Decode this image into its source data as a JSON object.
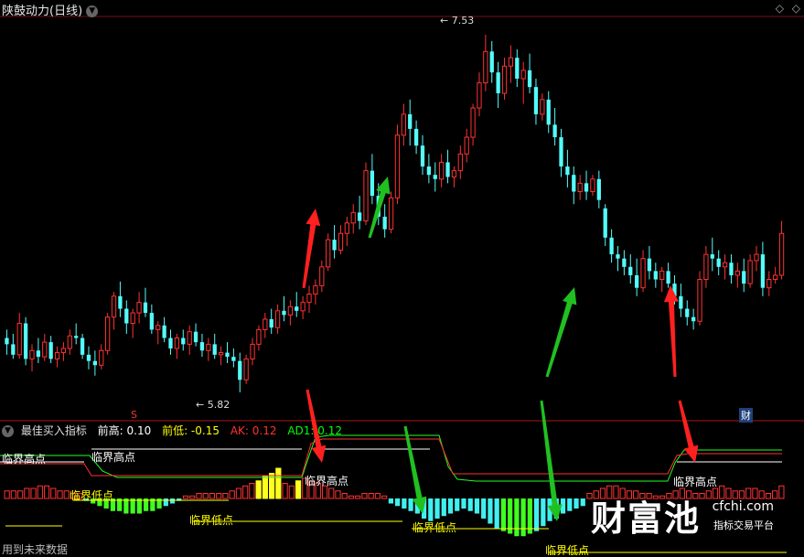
{
  "header": {
    "title": "陕鼓动力(日线)",
    "dropdown_icon": "chevron-down-icon",
    "corner_icons": [
      "diamond-icon",
      "diamond-icon"
    ]
  },
  "chart_data": [
    {
      "type": "candlestick",
      "title": "陕鼓动力(日线)",
      "annotations": {
        "high_label": "7.53",
        "low_label": "5.82",
        "s_marker": "S",
        "tag": "财"
      },
      "colors": {
        "up": "#ff3232",
        "down": "#54fcfc",
        "bg": "#000000"
      },
      "ylim": [
        5.75,
        7.6
      ],
      "candles": [
        {
          "o": 6.08,
          "h": 6.12,
          "l": 6.0,
          "c": 6.05
        },
        {
          "o": 6.05,
          "h": 6.1,
          "l": 5.98,
          "c": 6.0
        },
        {
          "o": 6.0,
          "h": 6.2,
          "l": 5.98,
          "c": 6.15
        },
        {
          "o": 6.15,
          "h": 6.18,
          "l": 5.95,
          "c": 5.98
        },
        {
          "o": 5.98,
          "h": 6.05,
          "l": 5.92,
          "c": 6.02
        },
        {
          "o": 6.02,
          "h": 6.08,
          "l": 5.96,
          "c": 5.99
        },
        {
          "o": 5.99,
          "h": 6.1,
          "l": 5.97,
          "c": 6.06
        },
        {
          "o": 6.06,
          "h": 6.09,
          "l": 5.96,
          "c": 5.98
        },
        {
          "o": 5.98,
          "h": 6.04,
          "l": 5.94,
          "c": 6.01
        },
        {
          "o": 6.01,
          "h": 6.06,
          "l": 5.97,
          "c": 6.03
        },
        {
          "o": 6.03,
          "h": 6.12,
          "l": 6.0,
          "c": 6.09
        },
        {
          "o": 6.09,
          "h": 6.15,
          "l": 6.05,
          "c": 6.08
        },
        {
          "o": 6.08,
          "h": 6.1,
          "l": 5.98,
          "c": 6.0
        },
        {
          "o": 6.0,
          "h": 6.04,
          "l": 5.93,
          "c": 5.97
        },
        {
          "o": 5.97,
          "h": 6.02,
          "l": 5.9,
          "c": 5.95
        },
        {
          "o": 5.95,
          "h": 6.05,
          "l": 5.93,
          "c": 6.02
        },
        {
          "o": 6.02,
          "h": 6.2,
          "l": 6.0,
          "c": 6.18
        },
        {
          "o": 6.18,
          "h": 6.3,
          "l": 6.12,
          "c": 6.28
        },
        {
          "o": 6.28,
          "h": 6.35,
          "l": 6.18,
          "c": 6.22
        },
        {
          "o": 6.22,
          "h": 6.26,
          "l": 6.1,
          "c": 6.15
        },
        {
          "o": 6.15,
          "h": 6.22,
          "l": 6.08,
          "c": 6.2
        },
        {
          "o": 6.2,
          "h": 6.3,
          "l": 6.15,
          "c": 6.25
        },
        {
          "o": 6.25,
          "h": 6.32,
          "l": 6.18,
          "c": 6.2
        },
        {
          "o": 6.2,
          "h": 6.24,
          "l": 6.1,
          "c": 6.12
        },
        {
          "o": 6.12,
          "h": 6.16,
          "l": 6.05,
          "c": 6.14
        },
        {
          "o": 6.14,
          "h": 6.18,
          "l": 6.06,
          "c": 6.08
        },
        {
          "o": 6.08,
          "h": 6.12,
          "l": 6.0,
          "c": 6.03
        },
        {
          "o": 6.03,
          "h": 6.1,
          "l": 5.98,
          "c": 6.08
        },
        {
          "o": 6.08,
          "h": 6.12,
          "l": 6.02,
          "c": 6.05
        },
        {
          "o": 6.05,
          "h": 6.14,
          "l": 6.0,
          "c": 6.11
        },
        {
          "o": 6.11,
          "h": 6.15,
          "l": 6.04,
          "c": 6.06
        },
        {
          "o": 6.06,
          "h": 6.1,
          "l": 5.99,
          "c": 6.02
        },
        {
          "o": 6.02,
          "h": 6.08,
          "l": 5.97,
          "c": 6.05
        },
        {
          "o": 6.05,
          "h": 6.1,
          "l": 5.98,
          "c": 6.0
        },
        {
          "o": 6.0,
          "h": 6.04,
          "l": 5.95,
          "c": 6.01
        },
        {
          "o": 6.01,
          "h": 6.06,
          "l": 5.96,
          "c": 5.99
        },
        {
          "o": 5.99,
          "h": 6.03,
          "l": 5.94,
          "c": 5.97
        },
        {
          "o": 5.97,
          "h": 6.01,
          "l": 5.82,
          "c": 5.88
        },
        {
          "o": 5.88,
          "h": 6.0,
          "l": 5.86,
          "c": 5.98
        },
        {
          "o": 5.98,
          "h": 6.08,
          "l": 5.95,
          "c": 6.05
        },
        {
          "o": 6.05,
          "h": 6.14,
          "l": 6.02,
          "c": 6.12
        },
        {
          "o": 6.12,
          "h": 6.2,
          "l": 6.08,
          "c": 6.17
        },
        {
          "o": 6.17,
          "h": 6.22,
          "l": 6.1,
          "c": 6.13
        },
        {
          "o": 6.13,
          "h": 6.24,
          "l": 6.1,
          "c": 6.21
        },
        {
          "o": 6.21,
          "h": 6.28,
          "l": 6.16,
          "c": 6.19
        },
        {
          "o": 6.19,
          "h": 6.26,
          "l": 6.14,
          "c": 6.23
        },
        {
          "o": 6.23,
          "h": 6.3,
          "l": 6.18,
          "c": 6.21
        },
        {
          "o": 6.21,
          "h": 6.28,
          "l": 6.17,
          "c": 6.25
        },
        {
          "o": 6.25,
          "h": 6.33,
          "l": 6.2,
          "c": 6.29
        },
        {
          "o": 6.29,
          "h": 6.36,
          "l": 6.24,
          "c": 6.33
        },
        {
          "o": 6.33,
          "h": 6.45,
          "l": 6.3,
          "c": 6.42
        },
        {
          "o": 6.42,
          "h": 6.58,
          "l": 6.4,
          "c": 6.55
        },
        {
          "o": 6.55,
          "h": 6.62,
          "l": 6.46,
          "c": 6.5
        },
        {
          "o": 6.5,
          "h": 6.62,
          "l": 6.48,
          "c": 6.58
        },
        {
          "o": 6.58,
          "h": 6.66,
          "l": 6.52,
          "c": 6.63
        },
        {
          "o": 6.63,
          "h": 6.72,
          "l": 6.58,
          "c": 6.68
        },
        {
          "o": 6.68,
          "h": 6.76,
          "l": 6.6,
          "c": 6.64
        },
        {
          "o": 6.64,
          "h": 6.92,
          "l": 6.62,
          "c": 6.88
        },
        {
          "o": 6.88,
          "h": 6.96,
          "l": 6.72,
          "c": 6.76
        },
        {
          "o": 6.76,
          "h": 6.82,
          "l": 6.62,
          "c": 6.66
        },
        {
          "o": 6.66,
          "h": 6.72,
          "l": 6.56,
          "c": 6.6
        },
        {
          "o": 6.6,
          "h": 6.78,
          "l": 6.58,
          "c": 6.75
        },
        {
          "o": 6.75,
          "h": 7.1,
          "l": 6.72,
          "c": 7.05
        },
        {
          "o": 7.05,
          "h": 7.2,
          "l": 7.0,
          "c": 7.15
        },
        {
          "o": 7.15,
          "h": 7.22,
          "l": 7.0,
          "c": 7.08
        },
        {
          "o": 7.08,
          "h": 7.12,
          "l": 6.96,
          "c": 7.0
        },
        {
          "o": 7.0,
          "h": 7.05,
          "l": 6.86,
          "c": 6.9
        },
        {
          "o": 6.9,
          "h": 6.96,
          "l": 6.82,
          "c": 6.86
        },
        {
          "o": 6.86,
          "h": 6.92,
          "l": 6.78,
          "c": 6.84
        },
        {
          "o": 6.84,
          "h": 6.96,
          "l": 6.8,
          "c": 6.92
        },
        {
          "o": 6.92,
          "h": 6.98,
          "l": 6.82,
          "c": 6.85
        },
        {
          "o": 6.85,
          "h": 6.9,
          "l": 6.8,
          "c": 6.88
        },
        {
          "o": 6.88,
          "h": 7.0,
          "l": 6.84,
          "c": 6.96
        },
        {
          "o": 6.96,
          "h": 7.08,
          "l": 6.92,
          "c": 7.04
        },
        {
          "o": 7.04,
          "h": 7.2,
          "l": 7.0,
          "c": 7.18
        },
        {
          "o": 7.18,
          "h": 7.35,
          "l": 7.14,
          "c": 7.3
        },
        {
          "o": 7.3,
          "h": 7.53,
          "l": 7.26,
          "c": 7.45
        },
        {
          "o": 7.45,
          "h": 7.5,
          "l": 7.3,
          "c": 7.35
        },
        {
          "o": 7.35,
          "h": 7.4,
          "l": 7.18,
          "c": 7.25
        },
        {
          "o": 7.25,
          "h": 7.42,
          "l": 7.22,
          "c": 7.38
        },
        {
          "o": 7.38,
          "h": 7.48,
          "l": 7.3,
          "c": 7.42
        },
        {
          "o": 7.42,
          "h": 7.46,
          "l": 7.28,
          "c": 7.32
        },
        {
          "o": 7.32,
          "h": 7.4,
          "l": 7.2,
          "c": 7.36
        },
        {
          "o": 7.36,
          "h": 7.44,
          "l": 7.25,
          "c": 7.28
        },
        {
          "o": 7.28,
          "h": 7.32,
          "l": 7.1,
          "c": 7.15
        },
        {
          "o": 7.15,
          "h": 7.25,
          "l": 7.12,
          "c": 7.22
        },
        {
          "o": 7.22,
          "h": 7.26,
          "l": 7.06,
          "c": 7.1
        },
        {
          "o": 7.1,
          "h": 7.18,
          "l": 7.0,
          "c": 7.04
        },
        {
          "o": 7.04,
          "h": 7.08,
          "l": 6.85,
          "c": 6.9
        },
        {
          "o": 6.9,
          "h": 6.98,
          "l": 6.8,
          "c": 6.86
        },
        {
          "o": 6.86,
          "h": 6.9,
          "l": 6.72,
          "c": 6.78
        },
        {
          "o": 6.78,
          "h": 6.86,
          "l": 6.74,
          "c": 6.82
        },
        {
          "o": 6.82,
          "h": 6.88,
          "l": 6.74,
          "c": 6.78
        },
        {
          "o": 6.78,
          "h": 6.86,
          "l": 6.76,
          "c": 6.84
        },
        {
          "o": 6.84,
          "h": 6.88,
          "l": 6.7,
          "c": 6.74
        },
        {
          "o": 6.7,
          "h": 6.72,
          "l": 6.52,
          "c": 6.56
        },
        {
          "o": 6.56,
          "h": 6.6,
          "l": 6.44,
          "c": 6.48
        },
        {
          "o": 6.48,
          "h": 6.52,
          "l": 6.4,
          "c": 6.46
        },
        {
          "o": 6.46,
          "h": 6.5,
          "l": 6.38,
          "c": 6.42
        },
        {
          "o": 6.42,
          "h": 6.48,
          "l": 6.34,
          "c": 6.38
        },
        {
          "o": 6.38,
          "h": 6.46,
          "l": 6.28,
          "c": 6.32
        },
        {
          "o": 6.32,
          "h": 6.5,
          "l": 6.3,
          "c": 6.46
        },
        {
          "o": 6.46,
          "h": 6.52,
          "l": 6.36,
          "c": 6.4
        },
        {
          "o": 6.4,
          "h": 6.44,
          "l": 6.32,
          "c": 6.36
        },
        {
          "o": 6.36,
          "h": 6.42,
          "l": 6.3,
          "c": 6.4
        },
        {
          "o": 6.4,
          "h": 6.44,
          "l": 6.32,
          "c": 6.34
        },
        {
          "o": 6.34,
          "h": 6.38,
          "l": 6.24,
          "c": 6.28
        },
        {
          "o": 6.28,
          "h": 6.34,
          "l": 6.18,
          "c": 6.22
        },
        {
          "o": 6.22,
          "h": 6.26,
          "l": 6.14,
          "c": 6.18
        },
        {
          "o": 6.18,
          "h": 6.22,
          "l": 6.12,
          "c": 6.16
        },
        {
          "o": 6.16,
          "h": 6.4,
          "l": 6.14,
          "c": 6.36
        },
        {
          "o": 6.36,
          "h": 6.52,
          "l": 6.32,
          "c": 6.48
        },
        {
          "o": 6.48,
          "h": 6.56,
          "l": 6.4,
          "c": 6.46
        },
        {
          "o": 6.46,
          "h": 6.5,
          "l": 6.38,
          "c": 6.42
        },
        {
          "o": 6.42,
          "h": 6.48,
          "l": 6.36,
          "c": 6.44
        },
        {
          "o": 6.44,
          "h": 6.48,
          "l": 6.34,
          "c": 6.38
        },
        {
          "o": 6.38,
          "h": 6.44,
          "l": 6.32,
          "c": 6.4
        },
        {
          "o": 6.4,
          "h": 6.46,
          "l": 6.3,
          "c": 6.34
        },
        {
          "o": 6.34,
          "h": 6.48,
          "l": 6.32,
          "c": 6.45
        },
        {
          "o": 6.45,
          "h": 6.52,
          "l": 6.4,
          "c": 6.48
        },
        {
          "o": 6.48,
          "h": 6.54,
          "l": 6.28,
          "c": 6.32
        },
        {
          "o": 6.32,
          "h": 6.4,
          "l": 6.28,
          "c": 6.36
        },
        {
          "o": 6.36,
          "h": 6.42,
          "l": 6.34,
          "c": 6.38
        },
        {
          "o": 6.38,
          "h": 6.64,
          "l": 6.36,
          "c": 6.58
        }
      ]
    },
    {
      "type": "bar",
      "title": "最佳买入指标",
      "legend": [
        {
          "label": "前高: 0.10",
          "color": "#ffffff"
        },
        {
          "label": "前低: -0.15",
          "color": "#ffff00"
        },
        {
          "label": "AK: 0.12",
          "color": "#ff3232"
        },
        {
          "label": "AD1: 0.12",
          "color": "#00ff00"
        }
      ],
      "annotations": [
        "临界高点",
        "临界高点",
        "临界高点",
        "临界低点",
        "临界低点",
        "临界高点",
        "临界低点",
        "临界低点"
      ],
      "ylim": [
        -0.3,
        0.3
      ],
      "values": [
        0.03,
        0.03,
        0.03,
        0.04,
        0.04,
        0.05,
        0.05,
        0.04,
        0.03,
        0.03,
        0.02,
        0.02,
        -0.01,
        -0.02,
        -0.03,
        -0.04,
        -0.05,
        -0.05,
        -0.06,
        -0.06,
        -0.06,
        -0.05,
        -0.05,
        -0.04,
        -0.03,
        -0.02,
        -0.01,
        0.01,
        0.01,
        0.02,
        0.02,
        0.02,
        0.02,
        0.02,
        0.03,
        0.04,
        0.05,
        0.06,
        0.07,
        0.09,
        0.1,
        0.12,
        0.06,
        0.05,
        0.07,
        0.08,
        0.07,
        0.06,
        0.05,
        0.04,
        0.03,
        0.02,
        0.01,
        0.01,
        0.02,
        0.02,
        0.02,
        0.01,
        -0.02,
        -0.03,
        -0.04,
        -0.05,
        -0.06,
        -0.08,
        -0.09,
        -0.08,
        -0.07,
        -0.06,
        -0.05,
        -0.04,
        -0.05,
        -0.06,
        -0.08,
        -0.1,
        -0.12,
        -0.13,
        -0.14,
        -0.15,
        -0.15,
        -0.14,
        -0.13,
        -0.11,
        -0.09,
        -0.08,
        -0.06,
        -0.05,
        -0.04,
        -0.03,
        0.02,
        0.03,
        0.04,
        0.05,
        0.05,
        0.04,
        0.03,
        0.03,
        0.02,
        0.02,
        0.01,
        0.01,
        0.02,
        0.03,
        0.04,
        0.03,
        0.02,
        0.02,
        0.03,
        0.04,
        0.05,
        0.04,
        0.03,
        0.03,
        0.04,
        0.04,
        0.03,
        0.02,
        0.03,
        0.05
      ]
    }
  ],
  "footer": {
    "text": "用到未来数据"
  },
  "watermark": {
    "brand": "财富池",
    "site": "cfchi.com",
    "sub": "指标交易平台"
  }
}
